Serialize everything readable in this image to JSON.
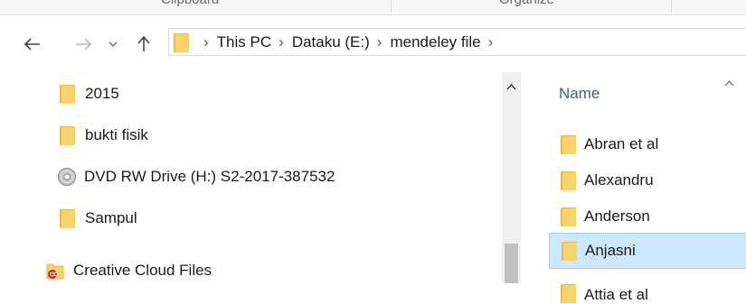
{
  "ribbon": {
    "groups": [
      "Clipboard",
      "Organize"
    ]
  },
  "toolbar": {
    "back_icon": "arrow-left-icon",
    "forward_icon": "arrow-right-icon",
    "recent_icon": "chevron-down-icon",
    "up_icon": "arrow-up-icon"
  },
  "address": {
    "crumbs": [
      "This PC",
      "Dataku (E:)",
      "mendeley file"
    ]
  },
  "nav_pane": {
    "items": [
      {
        "label": "2015",
        "icon": "folder-icon"
      },
      {
        "label": "bukti fisik",
        "icon": "folder-icon"
      },
      {
        "label": "DVD RW Drive (H:) S2-2017-387532",
        "icon": "dvd-drive-icon"
      },
      {
        "label": "Sampul",
        "icon": "folder-icon"
      },
      {
        "label": "Creative Cloud Files",
        "icon": "creative-cloud-icon"
      }
    ]
  },
  "file_list": {
    "column_name": "Name",
    "rows": [
      {
        "label": "Abran et al",
        "selected": false
      },
      {
        "label": "Alexandru",
        "selected": false
      },
      {
        "label": "Anderson",
        "selected": false
      },
      {
        "label": "Anjasni",
        "selected": true
      },
      {
        "label": "Attia et al",
        "selected": false
      }
    ]
  },
  "colors": {
    "folder": "#f6d36b",
    "folder_shadow": "#e9b949",
    "selection": "#cce8ff",
    "selection_border": "#99d1ff",
    "header_text": "#4c607a"
  }
}
